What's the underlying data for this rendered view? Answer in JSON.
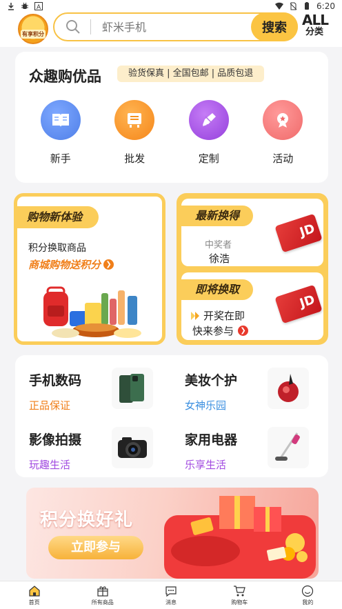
{
  "status_bar": {
    "time": "6:20"
  },
  "header": {
    "logo_text": "有享积分",
    "search_placeholder": "虾米手机",
    "search_button": "搜索",
    "category_all": "ALL",
    "category_label": "分类"
  },
  "zhongqu": {
    "title": "众趣购优品",
    "tag": "验货保真 | 全国包邮 | 品质包退",
    "items": [
      {
        "label": "新手",
        "icon": "book-icon",
        "color": "#4f7fe8"
      },
      {
        "label": "批发",
        "icon": "box-icon",
        "color": "#f5921e"
      },
      {
        "label": "定制",
        "icon": "pencil-icon",
        "color": "#a149e0"
      },
      {
        "label": "活动",
        "icon": "medal-icon",
        "color": "#f06a6a"
      }
    ]
  },
  "promo_left": {
    "tag": "购物新体验",
    "subtitle": "积分换取商品",
    "orange_text": "商城购物送积分"
  },
  "promo_right": {
    "top_tag": "最新换得",
    "winner_label": "中奖者",
    "winner_name": "徐浩",
    "bottom_tag": "即将换取",
    "line1": "开奖在即",
    "line2": "快来参与",
    "card_text": "JD"
  },
  "categories": [
    {
      "title": "手机数码",
      "subtitle": "正品保证",
      "color": "#f07f1a",
      "icon": "phone-icon"
    },
    {
      "title": "美妆个护",
      "subtitle": "女神乐园",
      "color": "#3b8fe0",
      "icon": "lipstick-icon"
    },
    {
      "title": "影像拍摄",
      "subtitle": "玩趣生活",
      "color": "#a149e0",
      "icon": "camera-icon"
    },
    {
      "title": "家用电器",
      "subtitle": "乐享生活",
      "color": "#a149e0",
      "icon": "vacuum-icon"
    }
  ],
  "banner": {
    "title": "积分换好礼",
    "button": "立即参与"
  },
  "tabbar": [
    {
      "label": "首页",
      "icon": "home-icon",
      "active": true
    },
    {
      "label": "所有商品",
      "icon": "gift-icon",
      "active": false
    },
    {
      "label": "消息",
      "icon": "message-icon",
      "active": false
    },
    {
      "label": "购物车",
      "icon": "cart-icon",
      "active": false
    },
    {
      "label": "我的",
      "icon": "profile-icon",
      "active": false
    }
  ],
  "colors": {
    "accent": "#fbc442",
    "promo_border": "#fbcd5a"
  }
}
